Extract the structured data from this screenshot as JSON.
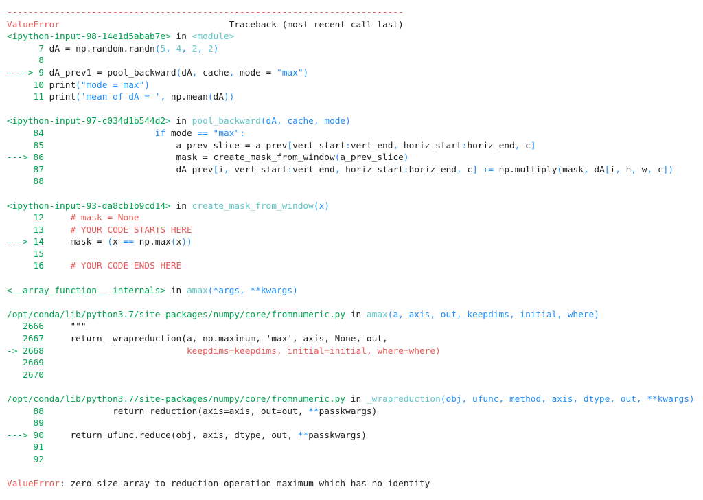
{
  "traceback": {
    "lines": [
      [
        {
          "t": "---------------------------------------------------------------------------",
          "c": "red"
        }
      ],
      [
        {
          "t": "ValueError",
          "c": "red"
        },
        {
          "t": "                                Traceback (most recent call last)",
          "c": "dark"
        }
      ],
      [
        {
          "t": "<ipython-input-98-14e1d5abab7e>",
          "c": "green"
        },
        {
          "t": " in ",
          "c": "dark"
        },
        {
          "t": "<module>",
          "c": "cyan"
        }
      ],
      [
        {
          "t": "      7 ",
          "c": "green"
        },
        {
          "t": "dA = np.random.randn",
          "c": "dark"
        },
        {
          "t": "(",
          "c": "blue"
        },
        {
          "t": "5",
          "c": "cyan"
        },
        {
          "t": ", ",
          "c": "blue"
        },
        {
          "t": "4",
          "c": "cyan"
        },
        {
          "t": ", ",
          "c": "blue"
        },
        {
          "t": "2",
          "c": "cyan"
        },
        {
          "t": ", ",
          "c": "blue"
        },
        {
          "t": "2",
          "c": "cyan"
        },
        {
          "t": ")",
          "c": "blue"
        }
      ],
      [
        {
          "t": "      8 ",
          "c": "green"
        }
      ],
      [
        {
          "t": "----> 9 ",
          "c": "green"
        },
        {
          "t": "dA_prev1 = pool_backward",
          "c": "dark"
        },
        {
          "t": "(",
          "c": "blue"
        },
        {
          "t": "dA",
          "c": "dark"
        },
        {
          "t": ", ",
          "c": "blue"
        },
        {
          "t": "cache",
          "c": "dark"
        },
        {
          "t": ", ",
          "c": "blue"
        },
        {
          "t": "mode = ",
          "c": "dark"
        },
        {
          "t": "\"max\"",
          "c": "blue"
        },
        {
          "t": ")",
          "c": "blue"
        }
      ],
      [
        {
          "t": "     10 ",
          "c": "green"
        },
        {
          "t": "print",
          "c": "dark"
        },
        {
          "t": "(",
          "c": "blue"
        },
        {
          "t": "\"mode = max\"",
          "c": "blue"
        },
        {
          "t": ")",
          "c": "blue"
        }
      ],
      [
        {
          "t": "     11 ",
          "c": "green"
        },
        {
          "t": "print",
          "c": "dark"
        },
        {
          "t": "(",
          "c": "blue"
        },
        {
          "t": "'mean of dA = '",
          "c": "blue"
        },
        {
          "t": ", ",
          "c": "blue"
        },
        {
          "t": "np.mean",
          "c": "dark"
        },
        {
          "t": "(",
          "c": "blue"
        },
        {
          "t": "dA",
          "c": "dark"
        },
        {
          "t": "))",
          "c": "blue"
        }
      ],
      [],
      [
        {
          "t": "<ipython-input-97-c034d1b544d2>",
          "c": "green"
        },
        {
          "t": " in ",
          "c": "dark"
        },
        {
          "t": "pool_backward",
          "c": "cyan"
        },
        {
          "t": "(dA, cache, mode)",
          "c": "blue"
        }
      ],
      [
        {
          "t": "     84 ",
          "c": "green"
        },
        {
          "t": "                    ",
          "c": "dark"
        },
        {
          "t": "if",
          "c": "blue"
        },
        {
          "t": " mode ",
          "c": "dark"
        },
        {
          "t": "==",
          "c": "blue"
        },
        {
          "t": " ",
          "c": "dark"
        },
        {
          "t": "\"max\"",
          "c": "blue"
        },
        {
          "t": ":",
          "c": "blue"
        }
      ],
      [
        {
          "t": "     85 ",
          "c": "green"
        },
        {
          "t": "                        a_prev_slice = a_prev",
          "c": "dark"
        },
        {
          "t": "[",
          "c": "blue"
        },
        {
          "t": "vert_start",
          "c": "dark"
        },
        {
          "t": ":",
          "c": "blue"
        },
        {
          "t": "vert_end",
          "c": "dark"
        },
        {
          "t": ", ",
          "c": "blue"
        },
        {
          "t": "horiz_start",
          "c": "dark"
        },
        {
          "t": ":",
          "c": "blue"
        },
        {
          "t": "horiz_end",
          "c": "dark"
        },
        {
          "t": ", ",
          "c": "blue"
        },
        {
          "t": "c",
          "c": "dark"
        },
        {
          "t": "]",
          "c": "blue"
        }
      ],
      [
        {
          "t": "---> 86 ",
          "c": "green"
        },
        {
          "t": "                        mask = create_mask_from_window",
          "c": "dark"
        },
        {
          "t": "(",
          "c": "blue"
        },
        {
          "t": "a_prev_slice",
          "c": "dark"
        },
        {
          "t": ")",
          "c": "blue"
        }
      ],
      [
        {
          "t": "     87 ",
          "c": "green"
        },
        {
          "t": "                        dA_prev",
          "c": "dark"
        },
        {
          "t": "[",
          "c": "blue"
        },
        {
          "t": "i",
          "c": "dark"
        },
        {
          "t": ", ",
          "c": "blue"
        },
        {
          "t": "vert_start",
          "c": "dark"
        },
        {
          "t": ":",
          "c": "blue"
        },
        {
          "t": "vert_end",
          "c": "dark"
        },
        {
          "t": ", ",
          "c": "blue"
        },
        {
          "t": "horiz_start",
          "c": "dark"
        },
        {
          "t": ":",
          "c": "blue"
        },
        {
          "t": "horiz_end",
          "c": "dark"
        },
        {
          "t": ", ",
          "c": "blue"
        },
        {
          "t": "c",
          "c": "dark"
        },
        {
          "t": "] += ",
          "c": "blue"
        },
        {
          "t": "np.multiply",
          "c": "dark"
        },
        {
          "t": "(",
          "c": "blue"
        },
        {
          "t": "mask",
          "c": "dark"
        },
        {
          "t": ", ",
          "c": "blue"
        },
        {
          "t": "dA",
          "c": "dark"
        },
        {
          "t": "[",
          "c": "blue"
        },
        {
          "t": "i",
          "c": "dark"
        },
        {
          "t": ", ",
          "c": "blue"
        },
        {
          "t": "h",
          "c": "dark"
        },
        {
          "t": ", ",
          "c": "blue"
        },
        {
          "t": "w",
          "c": "dark"
        },
        {
          "t": ", ",
          "c": "blue"
        },
        {
          "t": "c",
          "c": "dark"
        },
        {
          "t": "])",
          "c": "blue"
        }
      ],
      [
        {
          "t": "     88 ",
          "c": "green"
        }
      ],
      [],
      [
        {
          "t": "<ipython-input-93-da8cb1b9cd14>",
          "c": "green"
        },
        {
          "t": " in ",
          "c": "dark"
        },
        {
          "t": "create_mask_from_window",
          "c": "cyan"
        },
        {
          "t": "(x)",
          "c": "blue"
        }
      ],
      [
        {
          "t": "     12 ",
          "c": "green"
        },
        {
          "t": "    ",
          "c": "dark"
        },
        {
          "t": "# mask = None",
          "c": "red"
        }
      ],
      [
        {
          "t": "     13 ",
          "c": "green"
        },
        {
          "t": "    ",
          "c": "dark"
        },
        {
          "t": "# YOUR CODE STARTS HERE",
          "c": "red"
        }
      ],
      [
        {
          "t": "---> 14 ",
          "c": "green"
        },
        {
          "t": "    mask = ",
          "c": "dark"
        },
        {
          "t": "(",
          "c": "blue"
        },
        {
          "t": "x ",
          "c": "dark"
        },
        {
          "t": "==",
          "c": "blue"
        },
        {
          "t": " np.max",
          "c": "dark"
        },
        {
          "t": "(",
          "c": "blue"
        },
        {
          "t": "x",
          "c": "dark"
        },
        {
          "t": "))",
          "c": "blue"
        }
      ],
      [
        {
          "t": "     15 ",
          "c": "green"
        }
      ],
      [
        {
          "t": "     16 ",
          "c": "green"
        },
        {
          "t": "    ",
          "c": "dark"
        },
        {
          "t": "# YOUR CODE ENDS HERE",
          "c": "red"
        }
      ],
      [],
      [
        {
          "t": "<__array_function__ internals>",
          "c": "green"
        },
        {
          "t": " in ",
          "c": "dark"
        },
        {
          "t": "amax",
          "c": "cyan"
        },
        {
          "t": "(*args, **kwargs)",
          "c": "blue"
        }
      ],
      [],
      [
        {
          "t": "/opt/conda/lib/python3.7/site-packages/numpy/core/fromnumeric.py",
          "c": "green"
        },
        {
          "t": " in ",
          "c": "dark"
        },
        {
          "t": "amax",
          "c": "cyan"
        },
        {
          "t": "(a, axis, out, keepdims, initial, where)",
          "c": "blue"
        }
      ],
      [
        {
          "t": "   2666 ",
          "c": "green"
        },
        {
          "t": "    \"\"\"",
          "c": "dark"
        }
      ],
      [
        {
          "t": "   2667 ",
          "c": "green"
        },
        {
          "t": "    return _wrapreduction(a, np.maximum, 'max', axis, None, out,",
          "c": "dark"
        }
      ],
      [
        {
          "t": "-> 2668 ",
          "c": "green"
        },
        {
          "t": "                          ",
          "c": "dark"
        },
        {
          "t": "keepdims=keepdims, initial=initial, where=where)",
          "c": "red"
        }
      ],
      [
        {
          "t": "   2669 ",
          "c": "green"
        }
      ],
      [
        {
          "t": "   2670 ",
          "c": "green"
        }
      ],
      [],
      [
        {
          "t": "/opt/conda/lib/python3.7/site-packages/numpy/core/fromnumeric.py",
          "c": "green"
        },
        {
          "t": " in ",
          "c": "dark"
        },
        {
          "t": "_wrapreduction",
          "c": "cyan"
        },
        {
          "t": "(obj, ufunc, method, axis, dtype, out, **kwargs)",
          "c": "blue"
        }
      ],
      [
        {
          "t": "     88 ",
          "c": "green"
        },
        {
          "t": "            return reduction(axis=axis, out=out, ",
          "c": "dark"
        },
        {
          "t": "**",
          "c": "blue"
        },
        {
          "t": "passkwargs)",
          "c": "dark"
        }
      ],
      [
        {
          "t": "     89 ",
          "c": "green"
        }
      ],
      [
        {
          "t": "---> 90 ",
          "c": "green"
        },
        {
          "t": "    return ufunc.reduce(obj, axis, dtype, out, ",
          "c": "dark"
        },
        {
          "t": "**",
          "c": "blue"
        },
        {
          "t": "passkwargs)",
          "c": "dark"
        }
      ],
      [
        {
          "t": "     91 ",
          "c": "green"
        }
      ],
      [
        {
          "t": "     92 ",
          "c": "green"
        }
      ],
      [],
      [
        {
          "t": "ValueError",
          "c": "red"
        },
        {
          "t": ": zero-size array to reduction operation maximum which has no identity",
          "c": "dark"
        }
      ]
    ]
  }
}
